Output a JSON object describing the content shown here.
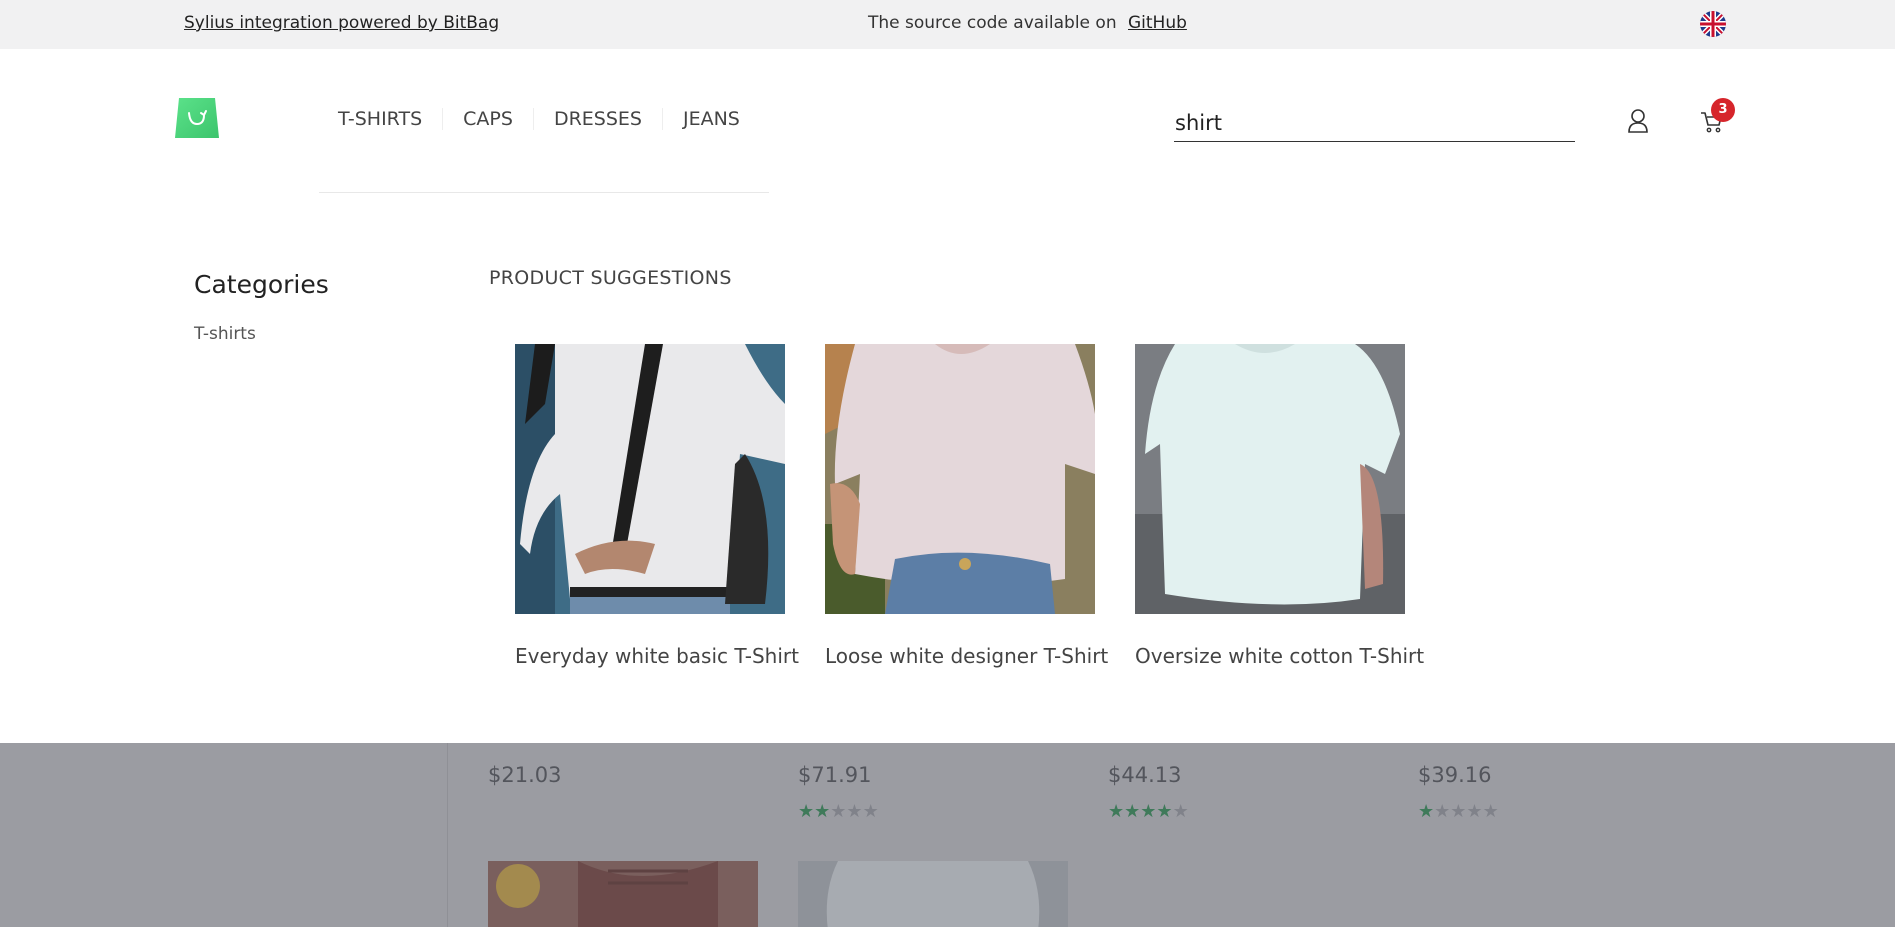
{
  "topbar": {
    "promo_link": "Sylius integration powered by BitBag",
    "source_text": "The source code available on",
    "github_link": "GitHub",
    "language_icon": "uk-flag-icon"
  },
  "header": {
    "logo_icon": "shopping-bag-logo-icon",
    "nav": [
      "T-SHIRTS",
      "CAPS",
      "DRESSES",
      "JEANS"
    ],
    "search_value": "shirt",
    "account_icon": "user-icon",
    "cart_icon": "cart-icon",
    "cart_count": "3"
  },
  "suggestions": {
    "categories_title": "Categories",
    "categories": [
      "T-shirts"
    ],
    "products_title": "PRODUCT SUGGESTIONS",
    "products": [
      {
        "name": "Everyday white basic T-Shirt"
      },
      {
        "name": "Loose white designer T-Shirt"
      },
      {
        "name": "Oversize white cotton T-Shirt"
      }
    ]
  },
  "background_listing": {
    "items": [
      {
        "price": "$21.03",
        "rating": 0
      },
      {
        "price": "$71.91",
        "rating": 2
      },
      {
        "price": "$44.13",
        "rating": 4
      },
      {
        "price": "$39.16",
        "rating": 1
      }
    ],
    "star_max": 5
  },
  "colors": {
    "accent_green": "#4cd47c",
    "badge_red": "#d6252b",
    "overlay_gray": "#9b9ca2",
    "star_green": "#3f7a5a"
  }
}
